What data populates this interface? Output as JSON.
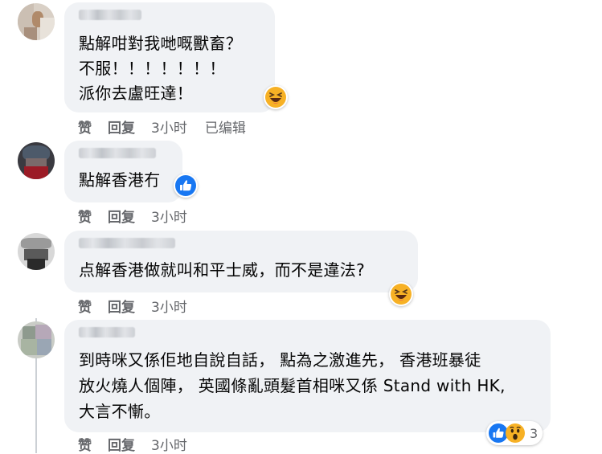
{
  "comments": [
    {
      "lines": [
        "點解咁對我哋嘅獸畜？",
        "不服！！！！！！！",
        "派你去盧旺達！"
      ],
      "reaction_icon": "laughing-emoji-icon",
      "actions": {
        "like": "赞",
        "reply": "回复",
        "time": "3小时",
        "edited": "已编辑"
      }
    },
    {
      "lines": [
        "點解香港冇"
      ],
      "reaction_icon": "like-reaction-icon",
      "actions": {
        "like": "赞",
        "reply": "回复",
        "time": "3小时"
      }
    },
    {
      "lines": [
        "点解香港做就叫和平士威，而不是違法?"
      ],
      "reaction_icon": "laughing-emoji-icon",
      "actions": {
        "like": "赞",
        "reply": "回复",
        "time": "3小时"
      }
    },
    {
      "lines": [
        "到時咪又係佢地自說自話， 點為之激進先， 香港班暴徒",
        "放火燒人個陣， 英國條亂頭髮首相咪又係 Stand with HK,",
        "大言不慚。"
      ],
      "reactions": [
        "like-reaction-icon",
        "wow-reaction-icon"
      ],
      "reaction_count": "3",
      "actions": {
        "like": "赞",
        "reply": "回复",
        "time": "3小时"
      }
    }
  ],
  "colors": {
    "bubble": "#f0f2f5",
    "meta": "#65676b",
    "like_blue": "#1877f2",
    "emoji_yellow": "#f7b125"
  }
}
